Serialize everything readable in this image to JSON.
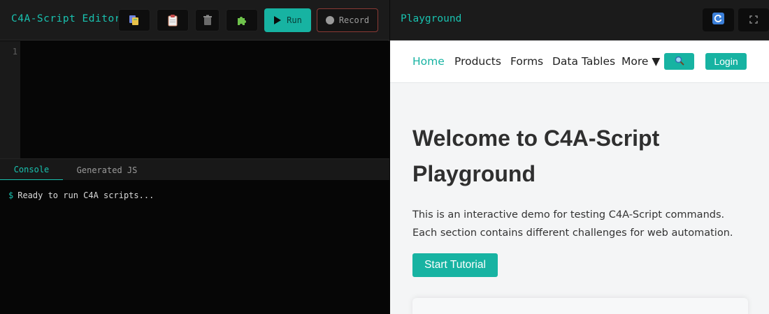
{
  "editor": {
    "title": "C4A-Script Editor",
    "toolbar": {
      "copy_icon": "copy-icon",
      "paste_icon": "clipboard-icon",
      "delete_icon": "trash-icon",
      "extension_icon": "puzzle-icon",
      "run_label": "Run",
      "record_label": "Record"
    },
    "line_numbers": [
      "1"
    ],
    "code": ""
  },
  "console": {
    "tabs": [
      {
        "label": "Console",
        "active": true
      },
      {
        "label": "Generated JS",
        "active": false
      }
    ],
    "prompt": "$",
    "output": "Ready to run C4A scripts..."
  },
  "playground": {
    "title": "Playground",
    "reset_icon": "refresh-icon",
    "fullscreen_icon": "fullscreen-icon",
    "site": {
      "nav": {
        "links": [
          "Home",
          "Products",
          "Forms",
          "Data Tables",
          "More ▼"
        ],
        "active": "Home",
        "search_icon": "search-icon",
        "login_label": "Login"
      },
      "hero_title": "Welcome to C4A-Script Playground",
      "hero_text": "This is an interactive demo for testing C4A-Script commands. Each section contains different challenges for web automation.",
      "cta_label": "Start Tutorial"
    }
  },
  "colors": {
    "accent": "#17b3a2",
    "editor_bg": "#070707",
    "header_bg": "#1b1b1b",
    "record_border": "#8a3a35"
  }
}
